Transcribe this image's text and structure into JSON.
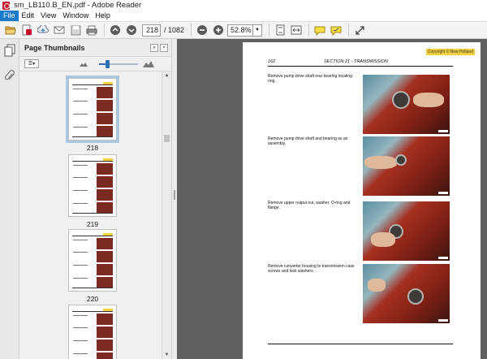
{
  "window": {
    "title": "sm_LB110.B_EN.pdf - Adobe Reader"
  },
  "menu": {
    "items": [
      "File",
      "Edit",
      "View",
      "Window",
      "Help"
    ],
    "active": "File"
  },
  "toolbar": {
    "current_page": "218",
    "total_pages": "/ 1082",
    "zoom": "52.8%",
    "icons": [
      "open-icon",
      "create-pdf-icon",
      "share-icon",
      "email-icon",
      "save-icon",
      "print-icon",
      "page-up-icon",
      "page-down-icon",
      "zoom-out-icon",
      "zoom-in-icon",
      "fit-page-icon",
      "fit-width-icon",
      "comment-icon",
      "sign-icon",
      "expand-icon"
    ]
  },
  "sidebar": {
    "panel_title": "Page Thumbnails",
    "thumbnails": [
      {
        "label": "218",
        "selected": true
      },
      {
        "label": "219",
        "selected": false
      },
      {
        "label": "220",
        "selected": false
      },
      {
        "label": "",
        "selected": false
      }
    ]
  },
  "document": {
    "copyright": "Copyright © New Holland",
    "page_number": "162",
    "section_title": "SECTION 21 - TRANSMISSION",
    "steps": [
      "Remove pump drive shaft rear bearing locating ring.",
      "Remove pump drive shaft and bearing as an assembly.",
      "Remove upper output nut, washer, O-ring and flange.",
      "Remove converter housing to transmission case screws and lock washers."
    ]
  },
  "colors": {
    "menu_active": "#1979ca",
    "doc_background": "#5f6060",
    "copyright_tag": "#f3d03e",
    "transmission_red": "#8a2418"
  }
}
